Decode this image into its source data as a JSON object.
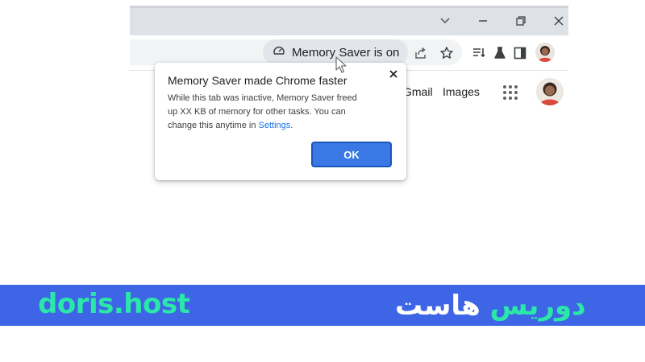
{
  "toolbar": {
    "memory_chip_label": "Memory Saver is on"
  },
  "page": {
    "nav_links": [
      "Gmail",
      "Images"
    ]
  },
  "bubble": {
    "title": "Memory Saver made Chrome faster",
    "body_text": "While this tab was inactive, Memory Saver freed up XX KB of memory for other tasks. You can change this anytime in ",
    "settings_link": "Settings",
    "body_end": ".",
    "ok_label": "OK"
  },
  "banner": {
    "brand_latin": "doris.host",
    "brand_persian_1": "دوریس",
    "brand_persian_2": "هاست"
  },
  "colors": {
    "accent_blue": "#3a78e6",
    "banner_blue": "#3d65e6",
    "brand_green": "#2be8a8",
    "link_blue": "#1a73e8"
  },
  "icons": [
    "chevron-down-icon",
    "minimize-icon",
    "restore-icon",
    "close-icon",
    "speedometer-icon",
    "share-icon",
    "star-icon",
    "reading-list-icon",
    "labs-flask-icon",
    "side-panel-icon",
    "profile-avatar",
    "apps-grid-icon",
    "mouse-cursor-icon"
  ]
}
